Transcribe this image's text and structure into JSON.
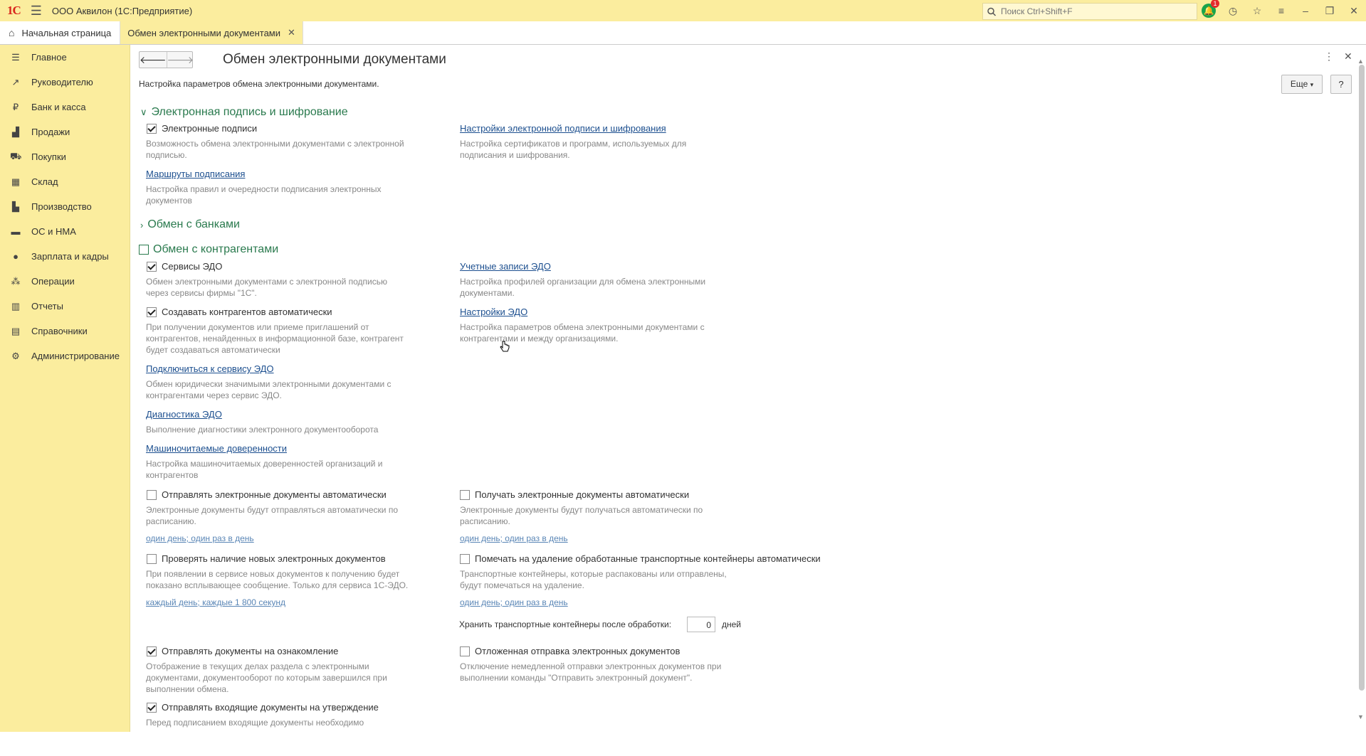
{
  "app": {
    "logo": "1С",
    "title": "ООО Аквилон  (1С:Предприятие)",
    "search_placeholder": "Поиск Ctrl+Shift+F",
    "notif_count": "1"
  },
  "tabs": {
    "home_label": "Начальная страница",
    "active_label": "Обмен электронными документами"
  },
  "sidebar": {
    "items": [
      {
        "label": "Главное",
        "icon": "menu-icon"
      },
      {
        "label": "Руководителю",
        "icon": "trend-icon"
      },
      {
        "label": "Банк и касса",
        "icon": "ruble-icon"
      },
      {
        "label": "Продажи",
        "icon": "bag-icon"
      },
      {
        "label": "Покупки",
        "icon": "cart-icon"
      },
      {
        "label": "Склад",
        "icon": "warehouse-icon"
      },
      {
        "label": "Производство",
        "icon": "factory-icon"
      },
      {
        "label": "ОС и НМА",
        "icon": "truck-icon"
      },
      {
        "label": "Зарплата и кадры",
        "icon": "person-icon"
      },
      {
        "label": "Операции",
        "icon": "operations-icon"
      },
      {
        "label": "Отчеты",
        "icon": "chart-icon"
      },
      {
        "label": "Справочники",
        "icon": "book-icon"
      },
      {
        "label": "Администрирование",
        "icon": "gear-icon"
      }
    ]
  },
  "page": {
    "title": "Обмен электронными документами",
    "description": "Настройка параметров обмена электронными документами.",
    "more_label": "Еще",
    "help_label": "?"
  },
  "sections": {
    "signature": "Электронная подпись и шифрование",
    "banks": "Обмен с банками",
    "counterparties": "Обмен с контрагентами"
  },
  "signature": {
    "cb_label": "Электронные подписи",
    "cb_hint_1": "Возможность обмена электронными документами с электронной",
    "cb_hint_2": "подписью.",
    "routes_link": "Маршруты подписания",
    "routes_hint_1": "Настройка правил и очередности подписания электронных",
    "routes_hint_2": "документов",
    "settings_link": "Настройки электронной подписи и шифрования",
    "settings_hint_1": "Настройка сертификатов и программ, используемых для",
    "settings_hint_2": "подписания и шифрования."
  },
  "cp": {
    "services_label": "Сервисы ЭДО",
    "services_hint_1": "Обмен электронными документами с электронной подписью",
    "services_hint_2": "через сервисы фирмы \"1С\".",
    "create_label": "Создавать контрагентов автоматически",
    "create_hint_1": "При получении документов или приеме приглашений от",
    "create_hint_2": "контрагентов, ненайденных в информационной базе, контрагент",
    "create_hint_3": "будет создаваться автоматически",
    "connect_link": "Подключиться к сервису ЭДО",
    "connect_hint_1": "Обмен юридически значимыми электронными документами с",
    "connect_hint_2": "контрагентами через сервис ЭДО.",
    "diag_link": "Диагностика ЭДО",
    "diag_hint": "Выполнение диагностики электронного документооборота",
    "mpoa_link": "Машиночитаемые доверенности",
    "mpoa_hint_1": "Настройка машиночитаемых доверенностей организаций и",
    "mpoa_hint_2": "контрагентов",
    "accounts_link": "Учетные записи ЭДО",
    "accounts_hint_1": "Настройка профилей организации для обмена электронными",
    "accounts_hint_2": "документами.",
    "edo_settings_link": "Настройки ЭДО",
    "edo_settings_hint_1": "Настройка параметров обмена электронными документами с",
    "edo_settings_hint_2": "контрагентами и между организациями.",
    "send_auto_label": "Отправлять электронные документы автоматически",
    "send_auto_hint_1": "Электронные документы будут отправляться автоматически по",
    "send_auto_hint_2": "расписанию.",
    "send_auto_sched": "один день; один раз в день",
    "receive_auto_label": "Получать электронные документы автоматически",
    "receive_auto_hint_1": "Электронные документы будут получаться автоматически по",
    "receive_auto_hint_2": "расписанию.",
    "receive_auto_sched": "один день; один раз в день",
    "check_new_label": "Проверять наличие новых электронных документов",
    "check_new_hint_1": "При появлении в сервисе новых документов к получению будет",
    "check_new_hint_2": "показано всплывающее сообщение. Только для сервиса 1С-ЭДО.",
    "check_new_sched": "каждый день; каждые 1 800 секунд",
    "mark_delete_label": "Помечать на удаление обработанные транспортные контейнеры автоматически",
    "mark_delete_hint_1": "Транспортные контейнеры, которые распакованы или отправлены,",
    "mark_delete_hint_2": "будут помечаться на удаление.",
    "mark_delete_sched": "один день; один раз в день",
    "keep_label": "Хранить транспортные контейнеры после обработки:",
    "keep_value": "0",
    "keep_unit": "дней",
    "review_label": "Отправлять документы на ознакомление",
    "review_hint_1": "Отображение в текущих делах  раздела с электронными",
    "review_hint_2": "документами, документооборот по которым завершился при",
    "review_hint_3": "выполнении обмена.",
    "deferred_label": "Отложенная отправка электронных документов",
    "deferred_hint_1": "Отключение немедленной отправки электронных документов при",
    "deferred_hint_2": "выполнении команды \"Отправить электронный документ\".",
    "approval_label": "Отправлять входящие документы на утверждение",
    "approval_hint_1": "Перед подписанием входящие документы необходимо"
  }
}
